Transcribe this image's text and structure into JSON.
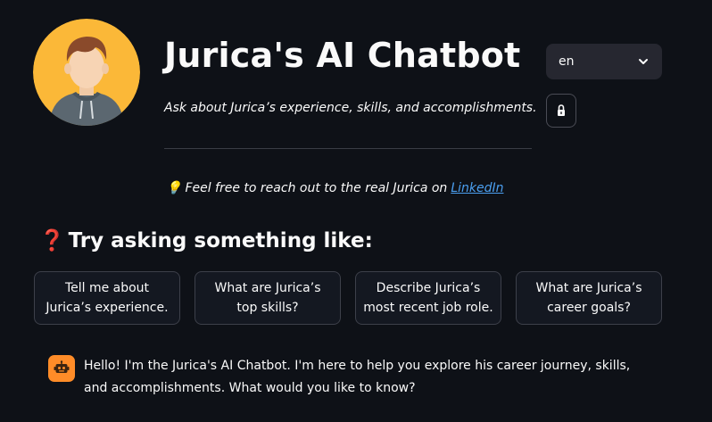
{
  "header": {
    "title": "Jurica's AI Chatbot",
    "subtitle": "Ask about Jurica’s experience, skills, and accomplishments."
  },
  "language_select": {
    "selected": "en"
  },
  "note": {
    "prefix": "Feel free to reach out to the real Jurica on",
    "link_text": "LinkedIn",
    "emoji": "💡"
  },
  "suggestions": {
    "heading_icon": "❓",
    "heading": "Try asking something like:",
    "items": [
      "Tell me about Jurica’s experience.",
      "What are Jurica’s top skills?",
      "Describe Jurica’s most recent job role.",
      "What are Jurica’s career goals?"
    ]
  },
  "chat": {
    "messages": [
      {
        "role": "assistant",
        "text": "Hello! I'm the Jurica's AI Chatbot. I'm here to help you explore his career journey, skills, and accomplishments. What would you like to know?"
      }
    ]
  },
  "colors": {
    "background": "#0e1117",
    "avatar_bg": "#fbb838",
    "link": "#4b9ff0",
    "bot_avatar": "#ff8c28",
    "question_mark": "#e8454d"
  },
  "icons": {
    "avatar": "person-avatar",
    "select_chevron": "chevron-down-icon",
    "lock": "lock-icon",
    "bulb": "lightbulb-icon",
    "question": "question-mark-icon",
    "bot": "robot-icon"
  }
}
